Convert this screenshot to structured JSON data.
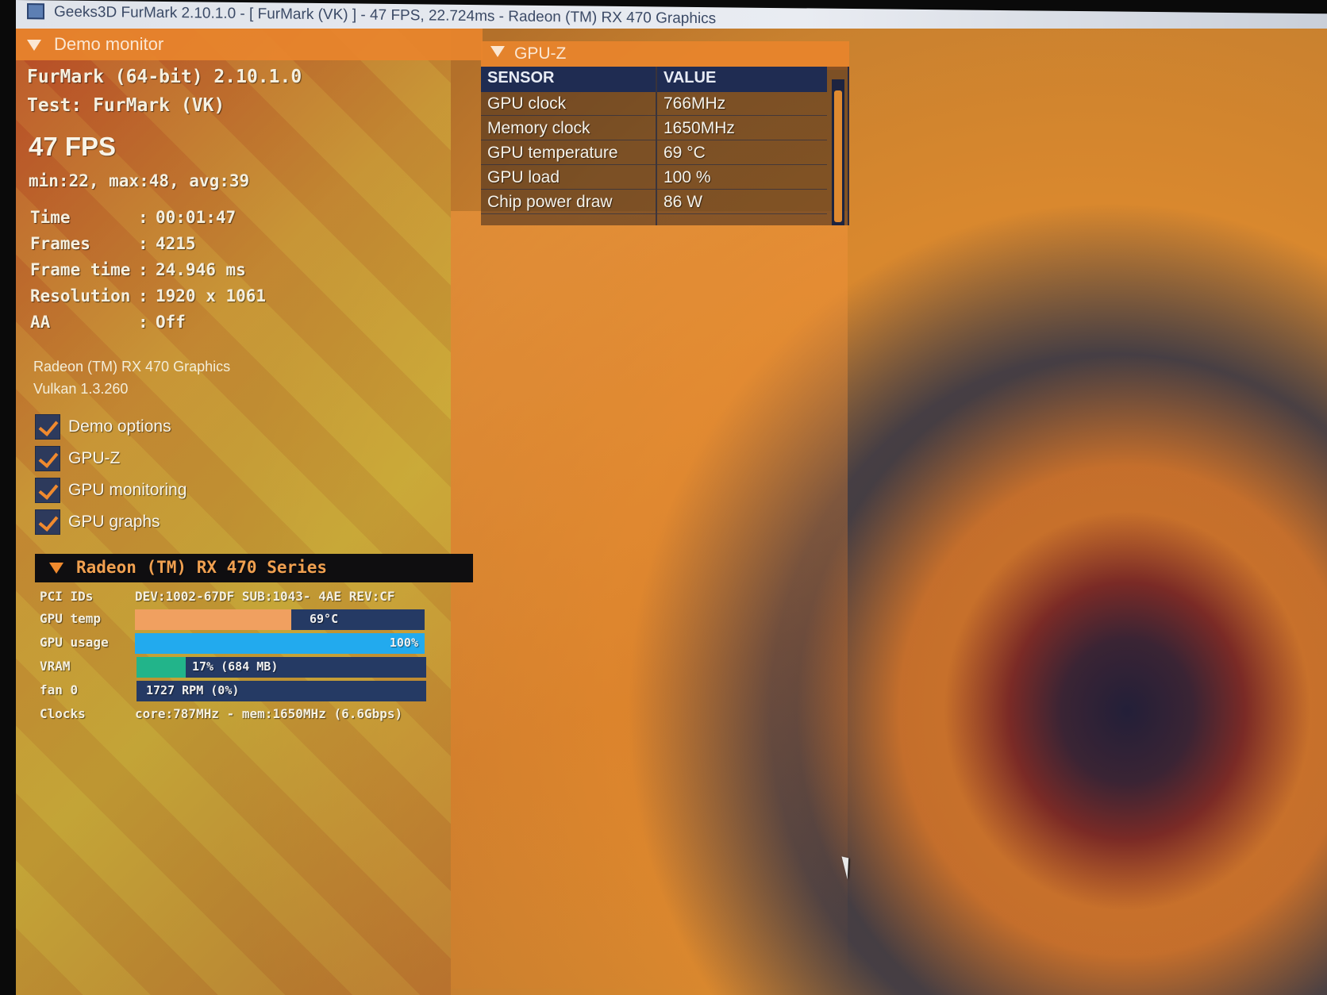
{
  "window": {
    "title": "Geeks3D FurMark 2.10.1.0 - [ FurMark (VK) ] - 47 FPS, 22.724ms - Radeon (TM) RX 470 Graphics"
  },
  "demo_monitor": {
    "header": "Demo monitor",
    "app": "FurMark (64-bit) 2.10.1.0",
    "test": "Test: FurMark (VK)",
    "fps": "47 FPS",
    "fps_stats": "min:22, max:48, avg:39",
    "stats": [
      {
        "key": "Time",
        "value": "00:01:47"
      },
      {
        "key": "Frames",
        "value": "4215"
      },
      {
        "key": "Frame time",
        "value": "24.946 ms"
      },
      {
        "key": "Resolution",
        "value": "1920 x 1061"
      },
      {
        "key": "AA",
        "value": "Off"
      }
    ],
    "gpu_name": "Radeon (TM) RX 470 Graphics",
    "api": "Vulkan 1.3.260",
    "options": [
      {
        "label": "Demo options",
        "checked": true
      },
      {
        "label": "GPU-Z",
        "checked": true
      },
      {
        "label": "GPU monitoring",
        "checked": true
      },
      {
        "label": "GPU graphs",
        "checked": true
      }
    ]
  },
  "gpu_series": {
    "header": "Radeon (TM) RX 470 Series",
    "rows": {
      "pci_label": "PCI IDs",
      "pci_value": "DEV:1002-67DF SUB:1043- 4AE REV:CF",
      "temp_label": "GPU temp",
      "temp_value": "69°C",
      "temp_fraction": 0.54,
      "usage_label": "GPU usage",
      "usage_value": "100%",
      "usage_fraction": 1.0,
      "vram_label": "VRAM",
      "vram_value": "17% (684 MB)",
      "vram_fraction": 0.17,
      "fan_label": "fan 0",
      "fan_value": "1727 RPM (0%)",
      "fan_fraction": 0.0,
      "clocks_label": "Clocks",
      "clocks_value": "core:787MHz - mem:1650MHz (6.6Gbps)"
    },
    "colors": {
      "temp": "#f0a060",
      "usage": "#22aaee",
      "vram": "#22b48a",
      "track": "#253a64"
    }
  },
  "gpuz": {
    "header": "GPU-Z",
    "col_sensor": "SENSOR",
    "col_value": "VALUE",
    "rows": [
      {
        "sensor": "GPU clock",
        "value": "766MHz"
      },
      {
        "sensor": "Memory clock",
        "value": "1650MHz"
      },
      {
        "sensor": "GPU temperature",
        "value": "69 °C"
      },
      {
        "sensor": "GPU load",
        "value": "100 %"
      },
      {
        "sensor": "Chip power draw",
        "value": "86 W"
      }
    ]
  }
}
